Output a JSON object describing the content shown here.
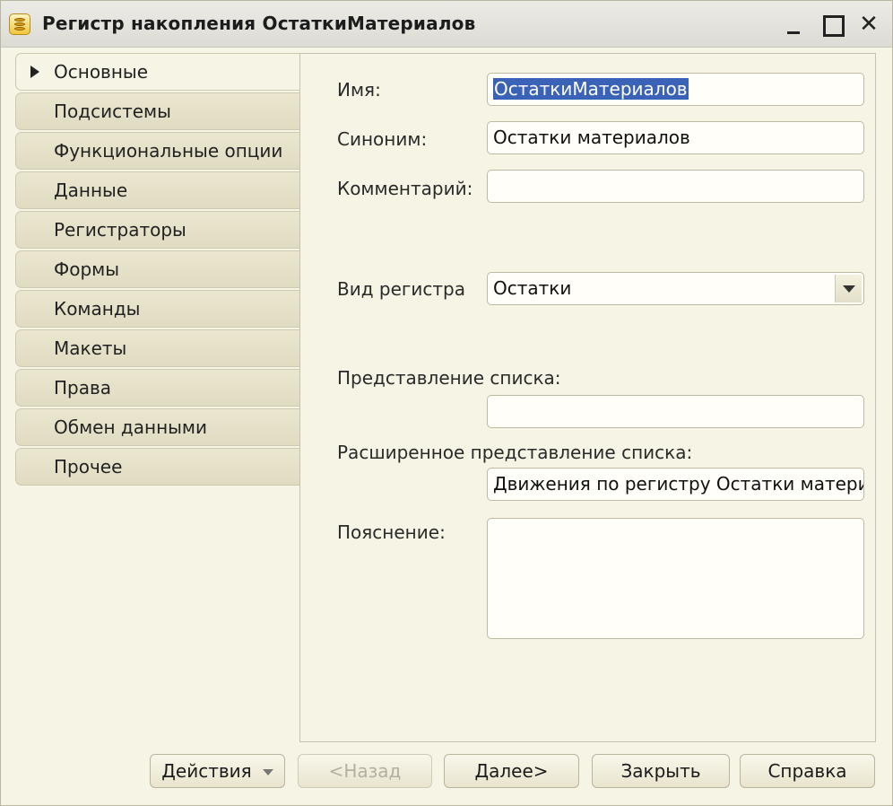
{
  "window": {
    "title": "Регистр накопления ОстаткиМатериалов"
  },
  "nav": {
    "items": [
      {
        "label": "Основные",
        "active": true
      },
      {
        "label": "Подсистемы"
      },
      {
        "label": "Функциональные опции"
      },
      {
        "label": "Данные"
      },
      {
        "label": "Регистраторы"
      },
      {
        "label": "Формы"
      },
      {
        "label": "Команды"
      },
      {
        "label": "Макеты"
      },
      {
        "label": "Права"
      },
      {
        "label": "Обмен данными"
      },
      {
        "label": "Прочее"
      }
    ]
  },
  "form": {
    "name_label": "Имя:",
    "name_value": "ОстаткиМатериалов",
    "synonym_label": "Синоним:",
    "synonym_value": "Остатки материалов",
    "comment_label": "Комментарий:",
    "comment_value": "",
    "register_kind_label": "Вид регистра",
    "register_kind_value": "Остатки",
    "list_presentation_label": "Представление списка:",
    "list_presentation_value": "",
    "ext_list_presentation_label": "Расширенное представление списка:",
    "ext_list_presentation_value": "Движения по регистру Остатки материалов",
    "explanation_label": "Пояснение:",
    "explanation_value": ""
  },
  "buttons": {
    "actions": "Действия",
    "back": "<Назад",
    "next": "Далее>",
    "close": "Закрыть",
    "help": "Справка"
  },
  "colors": {
    "background": "#f6f4e4",
    "selection": "#3a62b7",
    "tab_inactive": "#e4dfc6"
  }
}
